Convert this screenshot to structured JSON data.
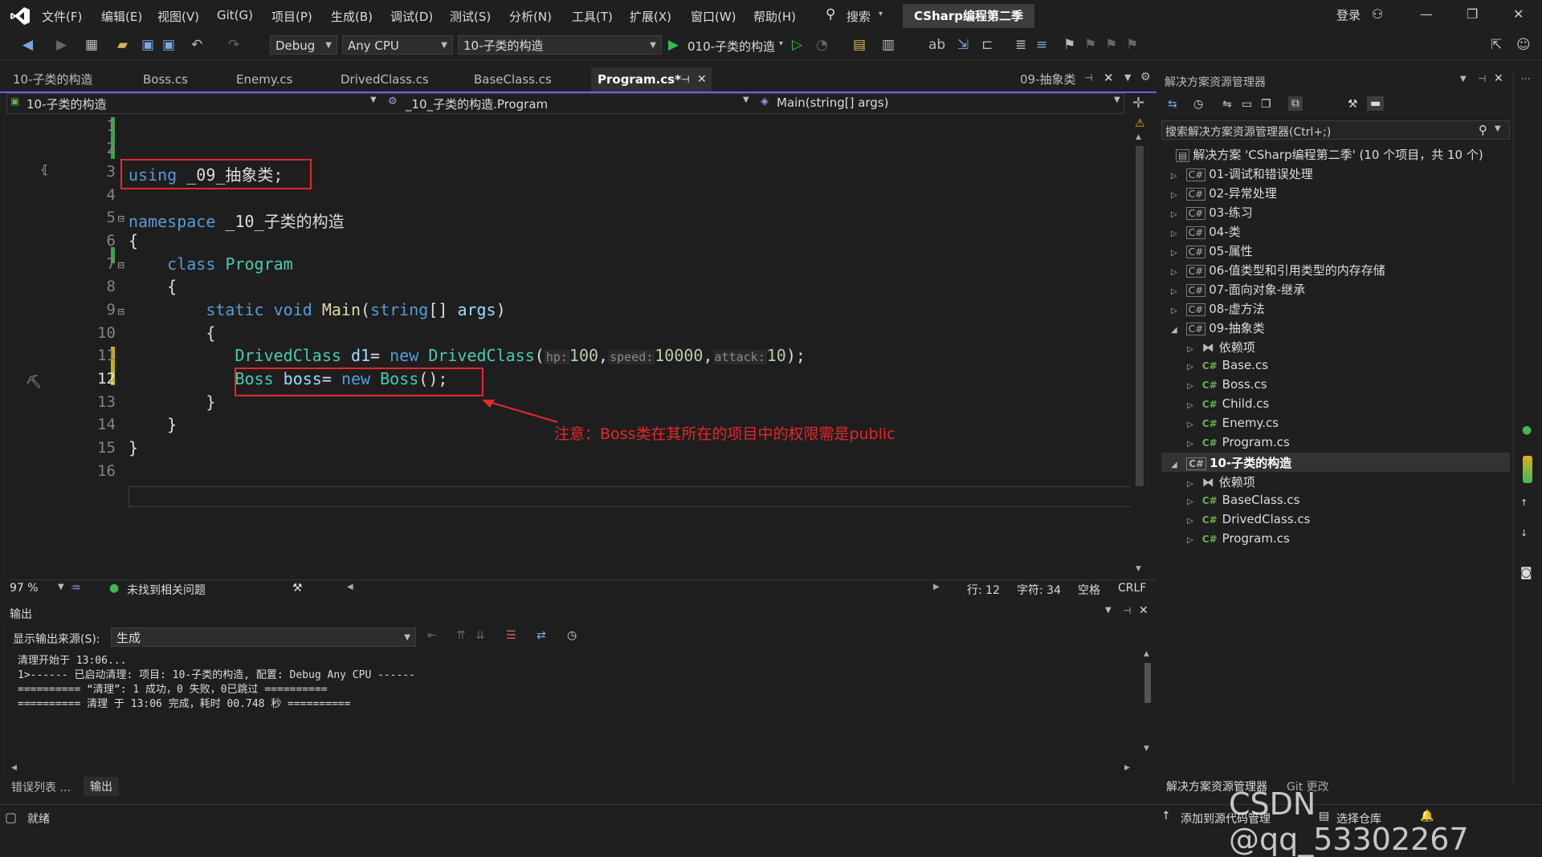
{
  "menu": {
    "items": [
      "文件(F)",
      "编辑(E)",
      "视图(V)",
      "Git(G)",
      "项目(P)",
      "生成(B)",
      "调试(D)",
      "测试(S)",
      "分析(N)",
      "工具(T)",
      "扩展(X)",
      "窗口(W)",
      "帮助(H)"
    ],
    "search": "搜索",
    "solution_title": "CSharp编程第二季",
    "login": "登录"
  },
  "toolbar": {
    "config": "Debug",
    "platform": "Any CPU",
    "startup_project": "10-子类的构造",
    "run_target": "010-子类的构造"
  },
  "tabs": {
    "left_label": "10-子类的构造",
    "files": [
      "Boss.cs",
      "Enemy.cs",
      "DrivedClass.cs",
      "BaseClass.cs",
      "Program.cs*"
    ],
    "right_label": "09-抽象类"
  },
  "navbar": {
    "project": "10-子类的构造",
    "type": "_10_子类的构造.Program",
    "member": "Main(string[] args)"
  },
  "code": {
    "lines": [
      "1",
      "2",
      "3",
      "4",
      "5",
      "6",
      "7",
      "8",
      "9",
      "10",
      "11",
      "12",
      "13",
      "14",
      "15",
      "16"
    ],
    "current_line": "12",
    "annotation": "注意：Boss类在其所在的项目中的权限需是public"
  },
  "editor_status": {
    "zoom": "97 %",
    "issues": "未找到相关问题",
    "row": "行: 12",
    "col": "字符: 34",
    "whitespace": "空格",
    "eol": "CRLF"
  },
  "output": {
    "title": "输出",
    "source_label": "显示输出来源(S):",
    "source_value": "生成",
    "lines": [
      "清理开始于 13:06...",
      "1>------ 已启动清理: 项目: 10-子类的构造, 配置: Debug Any CPU ------",
      "========== “清理”: 1 成功，0 失败，0已跳过 ==========",
      "========== 清理 于 13:06 完成，耗时 00.748 秒 =========="
    ]
  },
  "bottom_tabs": [
    "错误列表 ...",
    "输出"
  ],
  "solution_explorer": {
    "title": "解决方案资源管理器",
    "search_placeholder": "搜索解决方案资源管理器(Ctrl+;)",
    "root": "解决方案 'CSharp编程第二季' (10 个项目，共 10 个)",
    "projects": [
      "01-调试和错误处理",
      "02-异常处理",
      "03-练习",
      "04-类",
      "05-属性",
      "06-值类型和引用类型的内存存储",
      "07-面向对象-继承",
      "08-虚方法"
    ],
    "proj09": "09-抽象类",
    "proj09_children": [
      "依赖项",
      "Base.cs",
      "Boss.cs",
      "Child.cs",
      "Enemy.cs",
      "Program.cs"
    ],
    "proj10": "10-子类的构造",
    "proj10_children": [
      "依赖项",
      "BaseClass.cs",
      "DrivedClass.cs",
      "Program.cs"
    ],
    "bottom_tabs": [
      "解决方案资源管理器",
      "Git 更改"
    ]
  },
  "statusbar": {
    "ready": "就绪",
    "add_source": "添加到源代码管理",
    "select_repo": "选择仓库"
  },
  "watermark": "CSDN @qq_53302267",
  "colors": {
    "accent": "#7160e8",
    "annotation": "#e5272c"
  }
}
